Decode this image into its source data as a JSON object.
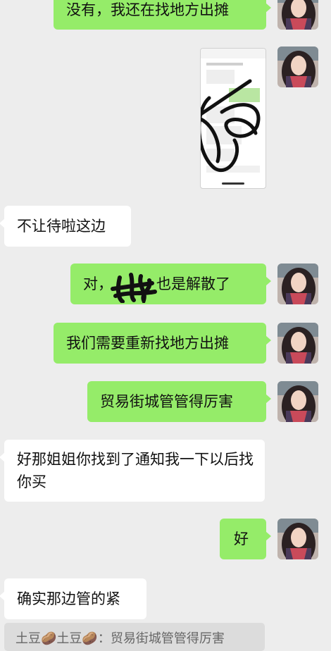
{
  "messages": {
    "m1": "没有，我还在找地方出摊",
    "m3": "不让待啦这边",
    "m4a": "对，",
    "m4b": "也是解散了",
    "m5": "我们需要重新找地方出摊",
    "m6": "贸易街城管管得厉害",
    "m7": "好那姐姐你找到了通知我一下以后找你买",
    "m8": "好",
    "m9": "确实那边管的紧"
  },
  "quote": {
    "sender": "土豆🥔土豆🥔",
    "separator": "：",
    "text": "贸易街城管管得厉害"
  },
  "colors": {
    "sent_bubble": "#95ec69",
    "received_bubble": "#ffffff",
    "background": "#ededed"
  }
}
